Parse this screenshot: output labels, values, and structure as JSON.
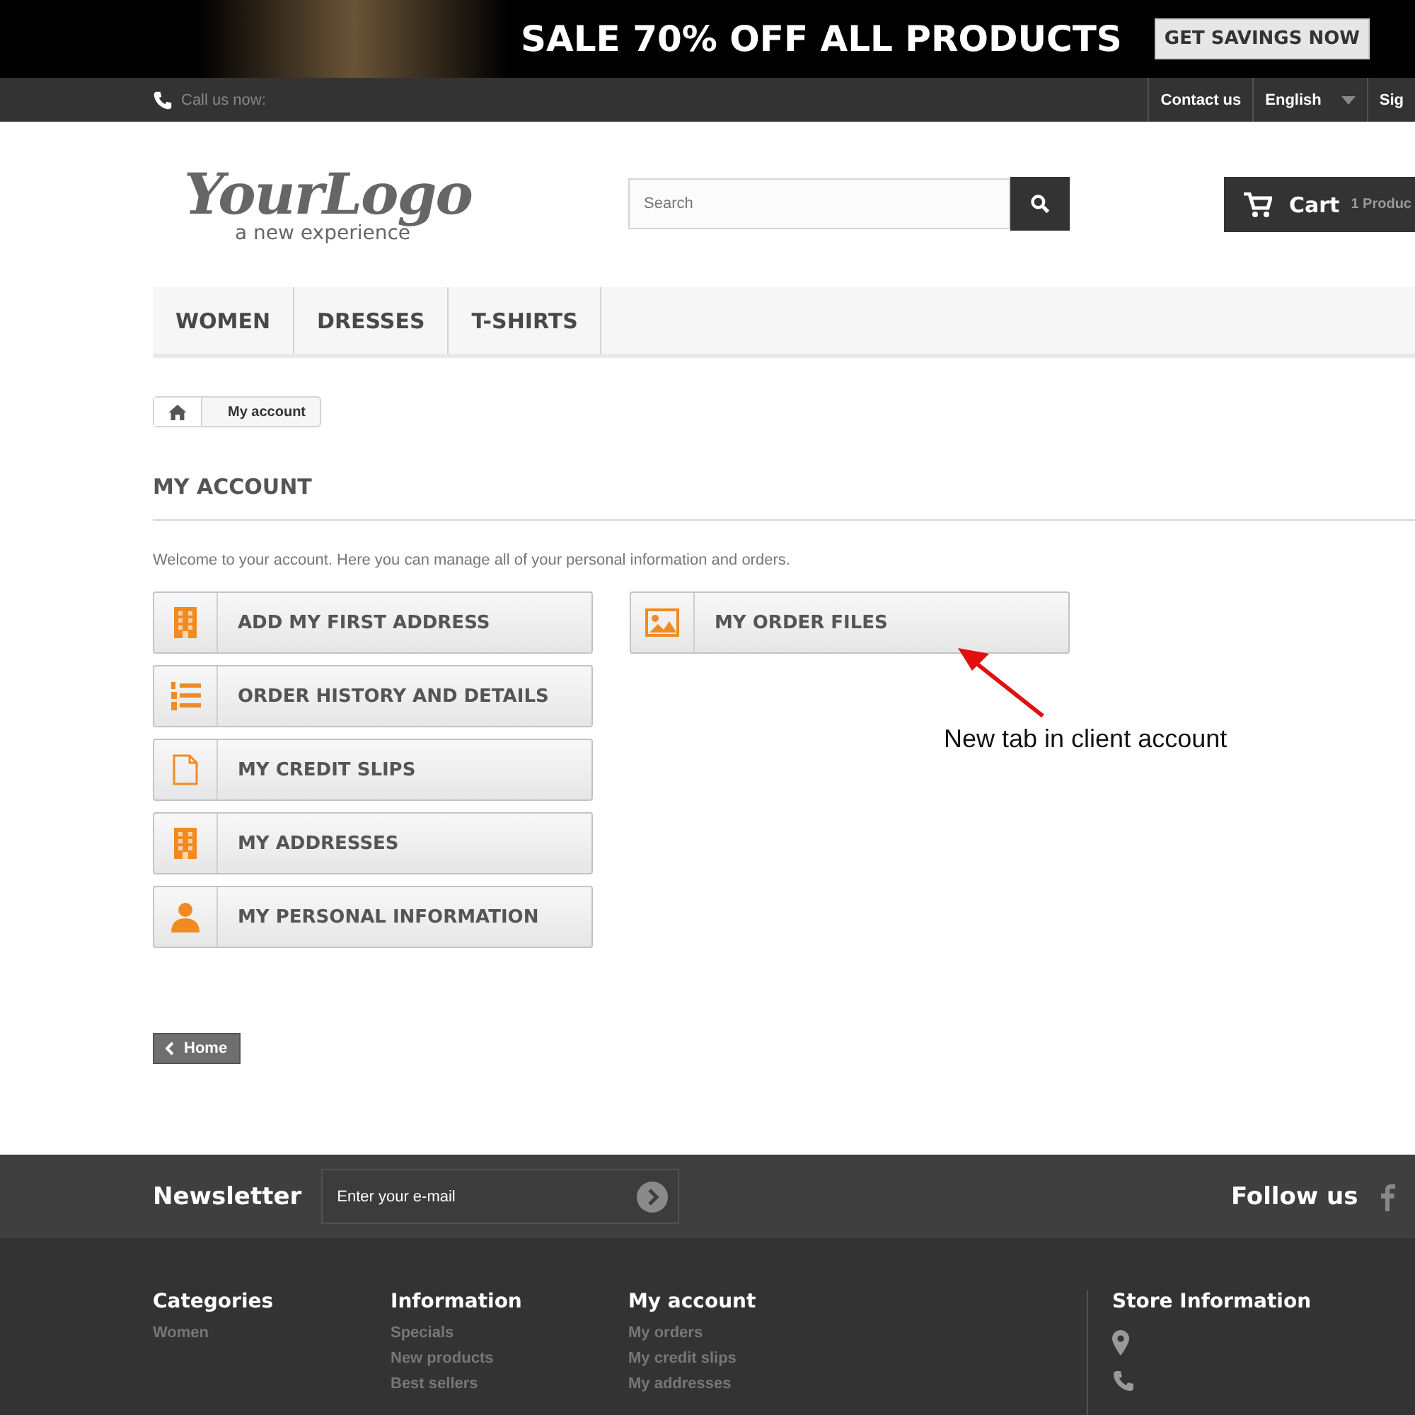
{
  "banner": {
    "headline": "SALE 70% OFF ALL PRODUCTS",
    "button": "GET SAVINGS NOW"
  },
  "topbar": {
    "phone_label": "Call us now:",
    "links": [
      {
        "label": "Contact us",
        "kind": "link"
      },
      {
        "label": "English",
        "kind": "dropdown"
      },
      {
        "label": "Sig",
        "kind": "link"
      }
    ]
  },
  "header": {
    "logo_text": "YourLogo",
    "logo_tagline": "a new experience",
    "search": {
      "placeholder": "Search"
    },
    "cart": {
      "label": "Cart",
      "count": "1 Produc"
    }
  },
  "menu": [
    {
      "label": "WOMEN"
    },
    {
      "label": "DRESSES"
    },
    {
      "label": "T-SHIRTS"
    }
  ],
  "breadcrumb": {
    "current": "My account"
  },
  "page": {
    "title": "MY ACCOUNT",
    "intro": "Welcome to your account. Here you can manage all of your personal information and orders.",
    "left_buttons": [
      {
        "label": "ADD MY FIRST ADDRESS",
        "kind": "building"
      },
      {
        "label": "ORDER HISTORY AND DETAILS",
        "kind": "list"
      },
      {
        "label": "MY CREDIT SLIPS",
        "kind": "file"
      },
      {
        "label": "MY ADDRESSES",
        "kind": "building"
      },
      {
        "label": "MY PERSONAL INFORMATION",
        "kind": "user"
      }
    ],
    "right_buttons": [
      {
        "label": "MY ORDER FILES",
        "kind": "image"
      }
    ],
    "annotation": "New tab in client account",
    "home_button": "Home"
  },
  "newsletter": {
    "title": "Newsletter",
    "placeholder": "Enter your e-mail",
    "follow": "Follow us"
  },
  "footer": {
    "columns": [
      {
        "title": "Categories",
        "links": [
          "Women"
        ]
      },
      {
        "title": "Information",
        "links": [
          "Specials",
          "New products",
          "Best sellers"
        ]
      },
      {
        "title": "My account",
        "links": [
          "My orders",
          "My credit slips",
          "My addresses"
        ]
      }
    ],
    "store_title": "Store Information"
  }
}
